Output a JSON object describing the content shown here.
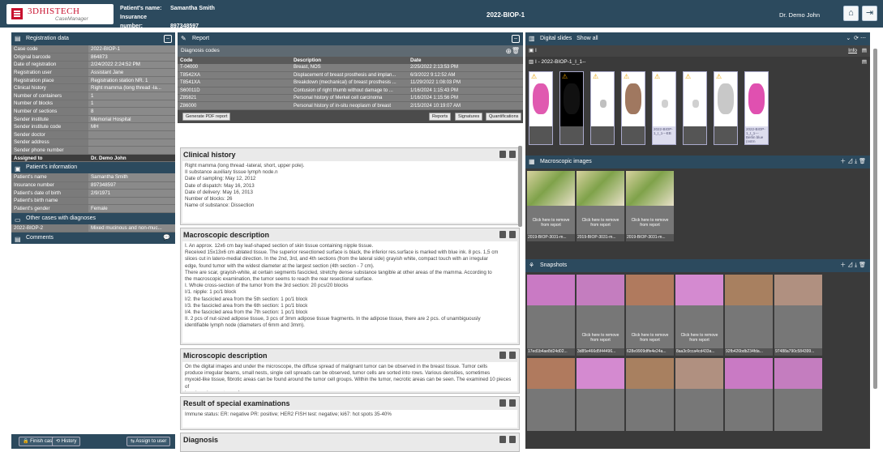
{
  "header": {
    "brand": "3DHISTECH",
    "product": "CaseManager",
    "patient_label": "Patient's name:",
    "patient_value": "Samantha Smith",
    "insurance_label": "Insurance number:",
    "insurance_value": "897348597",
    "case_id": "2022-BIOP-1",
    "user": "Dr. Demo John"
  },
  "registration": {
    "title": "Registration data",
    "rows": [
      [
        "Case code",
        "2022-BIOP-1"
      ],
      [
        "Original barcode",
        "864873"
      ],
      [
        "Date of registration",
        "2/24/2022 2:24:52 PM"
      ],
      [
        "Registration user",
        "Assistant Jane"
      ],
      [
        "Registration place",
        "Registration station NR. 1"
      ],
      [
        "Clinical history",
        "Right mamma (long thread -la..."
      ],
      [
        "Number of containers",
        "1"
      ],
      [
        "Number of blocks",
        "1"
      ],
      [
        "Number of sections",
        "8"
      ],
      [
        "Sender institute",
        "Memorial Hospital"
      ],
      [
        "Sender institute code",
        "MH"
      ],
      [
        "Sender doctor",
        ""
      ],
      [
        "Sender address",
        ""
      ],
      [
        "Sender phone number",
        ""
      ],
      [
        "Assigned to",
        "Dr. Demo John"
      ]
    ]
  },
  "patient": {
    "title": "Patient's information",
    "rows": [
      [
        "Patient's name",
        "Samantha Smith"
      ],
      [
        "Insurance number",
        "897348597"
      ],
      [
        "Patient's date of birth",
        "2/9/1971"
      ],
      [
        "Patient's birth name",
        ""
      ],
      [
        "Patient's gender",
        "Female"
      ]
    ]
  },
  "other_cases": {
    "title": "Other cases with diagnoses",
    "rows": [
      [
        "2022-BIOP-2",
        "Mixed mucinous and non-muc..."
      ]
    ]
  },
  "comments": {
    "title": "Comments"
  },
  "left_buttons": {
    "finish": "Finish case",
    "history": "History",
    "assign": "Assign to user"
  },
  "report": {
    "title": "Report",
    "diag_title": "Diagnosis codes",
    "cols": [
      "Code",
      "Description",
      "Date"
    ],
    "rows": [
      [
        "T-04000",
        "Breast, NOS",
        "2/25/2022 2:13:53 PM"
      ],
      [
        "T8542XA",
        "Displacement of breast prosthesis and implan...",
        "6/3/2022 9:12:52 AM"
      ],
      [
        "T8541XA",
        "Breakdown (mechanical) of breast prosthesis ...",
        "11/29/2022 1:08:03 PM"
      ],
      [
        "S60011D",
        "Contusion of right thumb without damage to ...",
        "1/16/2024 1:15:43 PM"
      ],
      [
        "Z85821",
        "Personal history of Merkel cell carcinoma",
        "1/16/2024 1:15:56 PM"
      ],
      [
        "Z86000",
        "Personal history of in-situ neoplasm of breast",
        "2/15/2024 10:19:07 AM"
      ]
    ],
    "pdf_btn": "Generate PDF report",
    "reports_btn": "Reports",
    "signatures_btn": "Signatures",
    "quant_btn": "Quantifications",
    "sections": [
      {
        "title": "Clinical history",
        "lines": [
          "Right mamma (long thread -lateral, short, upper pole).",
          "II substance auxiliary tissue lymph node.n",
          "Date of sampling: May 12, 2012",
          "Date of dispatch: May 16, 2013",
          "Date of delivery: May 16, 2013",
          "Number of blocks: 26",
          "Name of substance: Dissection"
        ]
      },
      {
        "title": "Macroscopic description",
        "lines": [
          "I. An approx. 12x6 cm bay leaf-shaped section of skin tissue containing nipple tissue.",
          "Received 15x13x6 cm ablated tissue. The superior resectioned surface is black, the inferior res.surface is marked with blue ink. 8 pcs. 1,5 cm",
          "slices cut in latero-medial direction. In the 2nd, 3rd, and 4th sections (from the lateral side) grayish white, compact touch with an irregular",
          "edge, found tumor with the widest diameter at the largest section (4th section - 7 cm).",
          "There are scar, grayish-white, at certain segments fascicled, stretchy dense substance tangible at other areas of the mamma. According to",
          "the macroscopic examination, the tumor seems to reach the rear resectional surface.",
          "I. Whole cross-section of the tumor from the 3rd section: 20 pcs/20 blocks",
          "I/1. nipple: 1 pc/1 block",
          "I/2. the fascicled area from the 5th section: 1 pc/1 block",
          "I/3. the fascicled area from the 6th section: 1 pc/1 block",
          "I/4. the fascicled area from the 7th section: 1 pc/1 block",
          "II. 2 pcs of nut-sized adipose tissue, 3 pcs of 3mm adipose tissue fragments. In the adipose tissue, there are 2 pcs. of unambiguously",
          "identifiable lymph node (diameters of 6mm and 3mm)."
        ]
      },
      {
        "title": "Microscopic description",
        "lines": [
          "On the digital images and under the microscope, the diffuse spread of malignant tumor can be observed in the breast tissue. Tumor cells",
          "produce irregular beams, small nests, single cell spreads can be observed, tumor cells are sorted into rows. Various densities, sometimes",
          "myxoid-like tissue, fibrotic areas can be found around the tumor cell groups. Within the tumor, necrotic areas can be seen. The examined 10 pieces of",
          "lymph nodes are tumor-free."
        ]
      },
      {
        "title": "Result of special examinations",
        "lines": [
          "Immune status: ER: negative PR: positive; HER2 FISH test: negative; ki67: hot spots 35-40%"
        ]
      },
      {
        "title": "Diagnosis",
        "lines": []
      }
    ]
  },
  "slides": {
    "title": "Digital slides",
    "show": "Show all",
    "group": "I",
    "info": "Info",
    "block": "I - 2022-BIOP-1_I_1--",
    "labels": [
      "",
      "",
      "",
      "",
      "2022-BIOP-1_I_1---EB",
      "",
      "",
      "2022-BIOP-1_I_1---Berlin blue (nstrn"
    ]
  },
  "macro": {
    "title": "Macroscopic images",
    "remove": "Click here to remove from report",
    "captions": [
      "2019-BIOP-3031-m...",
      "2019-BIOP-3031-m...",
      "2019-BIOP-3031-m..."
    ]
  },
  "snapshots": {
    "title": "Snapshots",
    "remove": "Click here to remove from report",
    "captions": [
      "17ed1b4ae8d24d02...",
      "3d85e466d5f44496...",
      "628e9909dffe4e24a...",
      "8aa3c0cca4cd433a...",
      "92fb426bdb234fda...",
      "97488a790c584399..."
    ]
  },
  "colors": {
    "header": "#2c4a5e",
    "brand": "#c8102e"
  }
}
